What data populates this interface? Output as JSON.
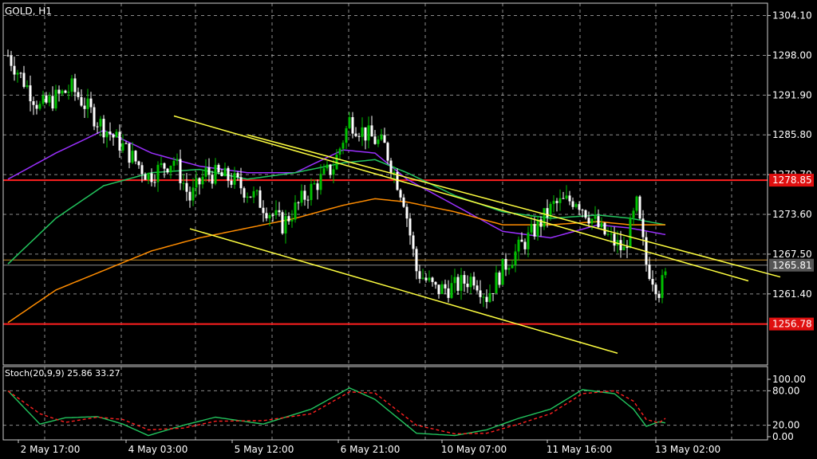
{
  "symbol_label": "GOLD, H1",
  "indicator_label": "Stoch(20,9,9) 25.86 33.27",
  "colors": {
    "background": "#000000",
    "grid": "#c8c8c8",
    "bull_candle": "#00c000",
    "bear_candle": "#ffffff",
    "ma_fast": "#9b30ff",
    "ma_mid": "#22c55e",
    "ma_slow": "#ff8c00",
    "trendline": "#ffff40",
    "level_line": "#ff2020",
    "stoch_main": "#22c55e",
    "stoch_signal": "#ff2020"
  },
  "chart_data": [
    {
      "type": "candlestick",
      "title": "GOLD, H1",
      "ylim": [
        1250.5,
        1306.0
      ],
      "y_ticks": [
        "1304.10",
        "1298.00",
        "1291.90",
        "1285.80",
        "1279.70",
        "1273.60",
        "1267.50",
        "1261.40"
      ],
      "x_ticks": [
        "2 May 17:00",
        "4 May 03:00",
        "5 May 12:00",
        "6 May 21:00",
        "10 May 07:00",
        "11 May 16:00",
        "13 May 02:00"
      ],
      "grid": true,
      "horizontal_levels": [
        {
          "price": 1278.85,
          "label": "1278.85",
          "color": "#ff2020"
        },
        {
          "price": 1256.78,
          "label": "1256.78",
          "color": "#ff2020"
        },
        {
          "price": 1266.6,
          "label": "",
          "color": "#c8902a"
        },
        {
          "price": 1265.81,
          "label": "1265.81",
          "color": "#8a8a8a"
        }
      ],
      "price_anchors": [
        [
          0,
          1298
        ],
        [
          10,
          1290
        ],
        [
          20,
          1293
        ],
        [
          28,
          1288
        ],
        [
          36,
          1284
        ],
        [
          44,
          1279.5
        ],
        [
          52,
          1282
        ],
        [
          57,
          1276
        ],
        [
          62,
          1280
        ],
        [
          70,
          1279
        ],
        [
          78,
          1276
        ],
        [
          86,
          1272
        ],
        [
          94,
          1277
        ],
        [
          102,
          1281
        ],
        [
          107,
          1288
        ],
        [
          112,
          1286
        ],
        [
          118,
          1284
        ],
        [
          124,
          1276
        ],
        [
          128,
          1265
        ],
        [
          134,
          1262
        ],
        [
          140,
          1262.5
        ],
        [
          146,
          1264
        ],
        [
          150,
          1261
        ],
        [
          156,
          1266
        ],
        [
          163,
          1270
        ],
        [
          171,
          1275
        ],
        [
          178,
          1276
        ],
        [
          186,
          1271
        ],
        [
          193,
          1268
        ],
        [
          197,
          1275
        ],
        [
          200,
          1266
        ],
        [
          204,
          1262
        ],
        [
          206,
          1264
        ]
      ],
      "moving_averages": [
        {
          "name": "",
          "color": "#9b30ff",
          "points": [
            [
              0,
              1279
            ],
            [
              15,
              1283
            ],
            [
              30,
              1286.5
            ],
            [
              45,
              1283
            ],
            [
              60,
              1281
            ],
            [
              75,
              1280
            ],
            [
              90,
              1280
            ],
            [
              105,
              1283.5
            ],
            [
              115,
              1283
            ],
            [
              125,
              1279
            ],
            [
              140,
              1275
            ],
            [
              155,
              1271
            ],
            [
              170,
              1270
            ],
            [
              185,
              1272
            ],
            [
              195,
              1271.5
            ],
            [
              206,
              1270.5
            ]
          ]
        },
        {
          "name": "",
          "color": "#22c55e",
          "points": [
            [
              0,
              1266
            ],
            [
              15,
              1273
            ],
            [
              30,
              1278
            ],
            [
              45,
              1280
            ],
            [
              60,
              1280.5
            ],
            [
              75,
              1279
            ],
            [
              90,
              1280
            ],
            [
              105,
              1281.5
            ],
            [
              115,
              1282
            ],
            [
              125,
              1280
            ],
            [
              140,
              1276.5
            ],
            [
              155,
              1274
            ],
            [
              170,
              1273
            ],
            [
              185,
              1273.5
            ],
            [
              195,
              1273
            ],
            [
              206,
              1272
            ]
          ]
        },
        {
          "name": "",
          "color": "#ff8c00",
          "points": [
            [
              0,
              1257
            ],
            [
              15,
              1262
            ],
            [
              30,
              1265
            ],
            [
              45,
              1268
            ],
            [
              60,
              1270
            ],
            [
              75,
              1271.5
            ],
            [
              90,
              1273
            ],
            [
              105,
              1275
            ],
            [
              115,
              1276
            ],
            [
              125,
              1275.5
            ],
            [
              140,
              1274
            ],
            [
              155,
              1272
            ],
            [
              170,
              1272
            ],
            [
              185,
              1272.5
            ],
            [
              195,
              1272
            ],
            [
              206,
              1272
            ]
          ]
        }
      ],
      "trendlines": [
        {
          "from": [
            52,
            1288.7
          ],
          "to": [
            232,
            1263.4
          ]
        },
        {
          "from": [
            75,
            1285.8
          ],
          "to": [
            242,
            1264.0
          ]
        },
        {
          "from": [
            57,
            1271.4
          ],
          "to": [
            191,
            1252.3
          ]
        }
      ]
    },
    {
      "type": "line",
      "title": "Stoch(20,9,9) 25.86 33.27",
      "ylim": [
        0,
        100
      ],
      "y_ticks": [
        "100.00",
        "80.00",
        "20.00",
        "0.00"
      ],
      "levels": [
        80,
        20
      ],
      "series": [
        {
          "name": "",
          "color": "#22c55e",
          "points": [
            [
              0,
              80
            ],
            [
              10,
              22
            ],
            [
              18,
              33
            ],
            [
              28,
              35
            ],
            [
              36,
              22
            ],
            [
              44,
              2
            ],
            [
              55,
              20
            ],
            [
              65,
              34
            ],
            [
              80,
              22
            ],
            [
              95,
              48
            ],
            [
              107,
              85
            ],
            [
              115,
              65
            ],
            [
              128,
              6
            ],
            [
              140,
              2
            ],
            [
              150,
              12
            ],
            [
              160,
              32
            ],
            [
              170,
              48
            ],
            [
              180,
              82
            ],
            [
              190,
              75
            ],
            [
              196,
              48
            ],
            [
              200,
              18
            ],
            [
              204,
              26
            ],
            [
              206,
              24
            ]
          ]
        },
        {
          "name": "",
          "color": "#ff2020",
          "dashed": true,
          "points": [
            [
              0,
              80
            ],
            [
              10,
              40
            ],
            [
              18,
              25
            ],
            [
              28,
              34
            ],
            [
              36,
              30
            ],
            [
              44,
              12
            ],
            [
              55,
              15
            ],
            [
              65,
              27
            ],
            [
              80,
              28
            ],
            [
              95,
              40
            ],
            [
              107,
              78
            ],
            [
              115,
              76
            ],
            [
              128,
              20
            ],
            [
              140,
              5
            ],
            [
              150,
              6
            ],
            [
              160,
              22
            ],
            [
              170,
              40
            ],
            [
              180,
              75
            ],
            [
              190,
              80
            ],
            [
              196,
              62
            ],
            [
              200,
              30
            ],
            [
              204,
              24
            ],
            [
              206,
              32
            ]
          ]
        }
      ]
    }
  ]
}
